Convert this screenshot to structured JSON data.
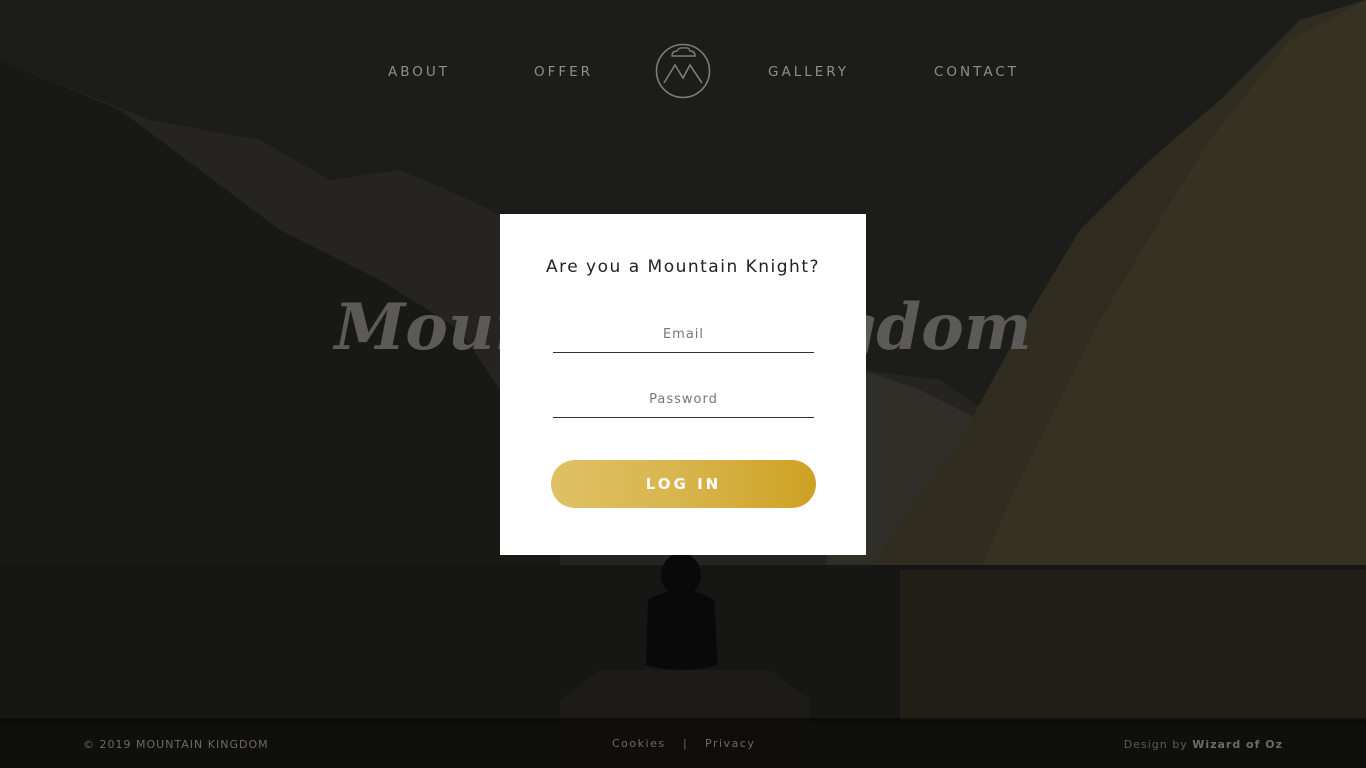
{
  "nav": {
    "items": [
      "ABOUT",
      "OFFER",
      "GALLERY",
      "CONTACT"
    ],
    "logo": "mountain-logo-icon"
  },
  "hero": {
    "title": "Mountain Kingdom"
  },
  "modal": {
    "title": "Are you a Mountain Knight?",
    "email_placeholder": "Email",
    "password_placeholder": "Password",
    "login_label": "LOG IN"
  },
  "footer": {
    "copyright": "© 2019 MOUNTAIN KINGDOM",
    "cookies": "Cookies",
    "separator": "|",
    "privacy": "Privacy",
    "design_prefix": "Design by",
    "design_author": "Wizard of Oz"
  },
  "colors": {
    "accent_gold": "#d4af37",
    "modal_bg": "#ffffff"
  }
}
